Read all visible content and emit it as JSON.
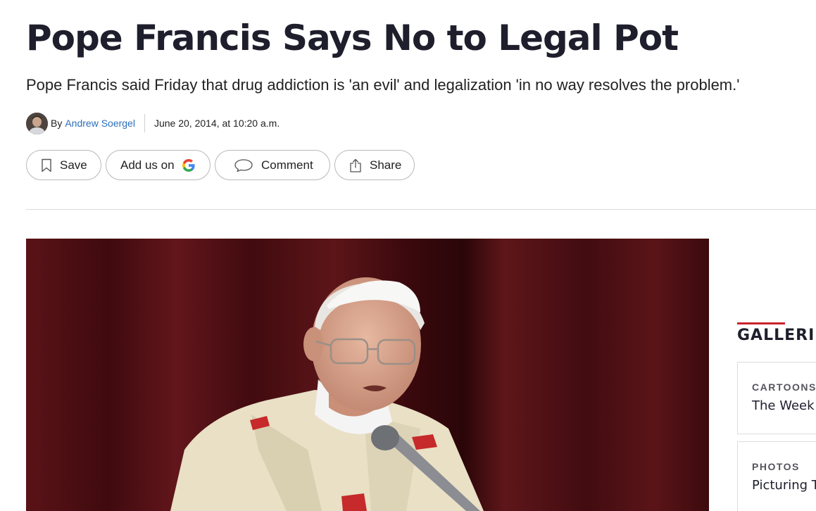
{
  "article": {
    "headline": "Pope Francis Says No to Legal Pot",
    "subheadline": "Pope Francis said Friday that drug addiction is 'an evil' and legalization 'in no way resolves the problem.'",
    "byline": {
      "prefix": "By",
      "author": "Andrew Soergel",
      "date": "June 20, 2014, at 10:20 a.m."
    }
  },
  "actions": {
    "save_label": "Save",
    "google_label": "Add us on",
    "comment_label": "Comment",
    "share_label": "Share"
  },
  "icons": {
    "save": "bookmark-icon",
    "google": "google-logo-icon",
    "comment": "speech-bubble-icon",
    "share": "share-upload-icon"
  },
  "sidebar": {
    "heading": "GALLERI",
    "cards": [
      {
        "kicker": "CARTOONS",
        "title": "The Week"
      },
      {
        "kicker": "PHOTOS",
        "title": "Picturing T"
      }
    ]
  },
  "colors": {
    "headline": "#1e1e2c",
    "link": "#2a6ebb",
    "accent": "#c8232c",
    "curtain": "#4a0e12"
  }
}
